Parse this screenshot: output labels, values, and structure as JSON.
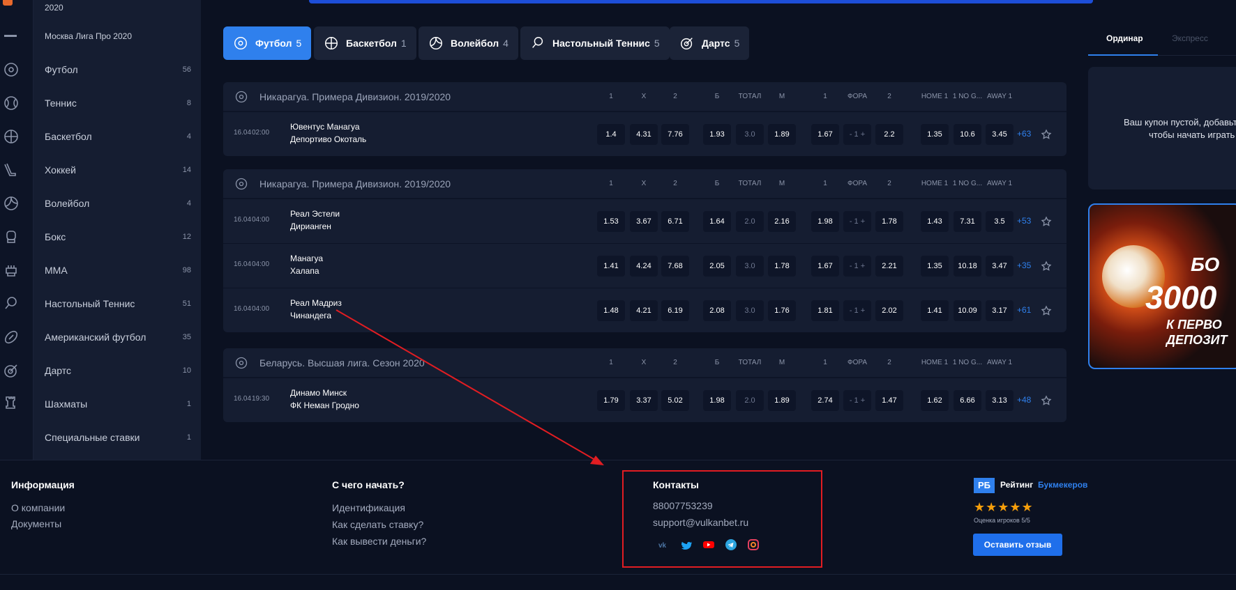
{
  "sidebar": {
    "top_label": "2020",
    "items": [
      {
        "label": "Москва Лига Про 2020",
        "count": ""
      },
      {
        "label": "Футбол",
        "count": "56"
      },
      {
        "label": "Теннис",
        "count": "8"
      },
      {
        "label": "Баскетбол",
        "count": "4"
      },
      {
        "label": "Хоккей",
        "count": "14"
      },
      {
        "label": "Волейбол",
        "count": "4"
      },
      {
        "label": "Бокс",
        "count": "12"
      },
      {
        "label": "MMA",
        "count": "98"
      },
      {
        "label": "Настольный Теннис",
        "count": "51"
      },
      {
        "label": "Американский футбол",
        "count": "35"
      },
      {
        "label": "Дартс",
        "count": "10"
      },
      {
        "label": "Шахматы",
        "count": "1"
      },
      {
        "label": "Специальные ставки",
        "count": "1"
      }
    ]
  },
  "tabs": [
    {
      "label": "Футбол",
      "count": "5",
      "icon": "soccer-ball-icon"
    },
    {
      "label": "Баскетбол",
      "count": "1",
      "icon": "basketball-icon"
    },
    {
      "label": "Волейбол",
      "count": "4",
      "icon": "volleyball-icon"
    },
    {
      "label": "Настольный Теннис",
      "count": "5",
      "icon": "table-tennis-icon"
    },
    {
      "label": "Дартс",
      "count": "5",
      "icon": "darts-icon"
    }
  ],
  "columns": [
    "1",
    "X",
    "2",
    "Б",
    "ТОТАЛ",
    "М",
    "1",
    "ФОРА",
    "2",
    "HOME 1",
    "1 NO G...",
    "AWAY 1"
  ],
  "leagues": [
    {
      "title": "Никарагуа. Примера Дивизион. 2019/2020",
      "matches": [
        {
          "date": "16.04",
          "time": "02:00",
          "home": "Ювентус Манагуа",
          "away": "Депортиво Окоталь",
          "odds": [
            "1.4",
            "4.31",
            "7.76",
            "1.93",
            "3.0",
            "1.89",
            "1.67",
            "- 1 +",
            "2.2",
            "1.35",
            "10.6",
            "3.45"
          ],
          "more": "+63"
        }
      ]
    },
    {
      "title": "Никарагуа. Примера Дивизион. 2019/2020",
      "matches": [
        {
          "date": "16.04",
          "time": "04:00",
          "home": "Реал Эстели",
          "away": "Дирианген",
          "odds": [
            "1.53",
            "3.67",
            "6.71",
            "1.64",
            "2.0",
            "2.16",
            "1.98",
            "- 1 +",
            "1.78",
            "1.43",
            "7.31",
            "3.5"
          ],
          "more": "+53"
        },
        {
          "date": "16.04",
          "time": "04:00",
          "home": "Манагуа",
          "away": "Халапа",
          "odds": [
            "1.41",
            "4.24",
            "7.68",
            "2.05",
            "3.0",
            "1.78",
            "1.67",
            "- 1 +",
            "2.21",
            "1.35",
            "10.18",
            "3.47"
          ],
          "more": "+35"
        },
        {
          "date": "16.04",
          "time": "04:00",
          "home": "Реал Мадриз",
          "away": "Чинандега",
          "odds": [
            "1.48",
            "4.21",
            "6.19",
            "2.08",
            "3.0",
            "1.76",
            "1.81",
            "- 1 +",
            "2.02",
            "1.41",
            "10.09",
            "3.17"
          ],
          "more": "+61"
        }
      ]
    },
    {
      "title": "Беларусь. Высшая лига. Сезон 2020",
      "matches": [
        {
          "date": "16.04",
          "time": "19:30",
          "home": "Динамо Минск",
          "away": "ФК Неман Гродно",
          "odds": [
            "1.79",
            "3.37",
            "5.02",
            "1.98",
            "2.0",
            "1.89",
            "2.74",
            "- 1 +",
            "1.47",
            "1.62",
            "6.66",
            "3.13"
          ],
          "more": "+48"
        }
      ]
    }
  ],
  "right": {
    "tab_single": "Ординар",
    "tab_express": "Экспресс",
    "coupon_line1": "Ваш купон пустой, добавьте",
    "coupon_line2": "чтобы начать играть",
    "banner_l1": "БО",
    "banner_l2": "3000",
    "banner_l3": "К ПЕРВО",
    "banner_l4": "ДЕПОЗИТ"
  },
  "footer": {
    "info_title": "Информация",
    "info_links": [
      "О компании",
      "Документы"
    ],
    "start_title": "С чего начать?",
    "start_links": [
      "Идентификация",
      "Как сделать ставку?",
      "Как вывести деньги?"
    ],
    "contacts_title": "Контакты",
    "phone": "88007753239",
    "email": "support@vulkanbet.ru",
    "rating_logo": "РБ",
    "rating_title": "Рейтинг",
    "rating_link": "Букмекеров",
    "stars": "★★★★★",
    "rating_text": "Оценка игроков 5/5",
    "review_button": "Оставить отзыв"
  },
  "colors": {
    "accent": "#2f80ed",
    "annotation": "#e11d22"
  }
}
